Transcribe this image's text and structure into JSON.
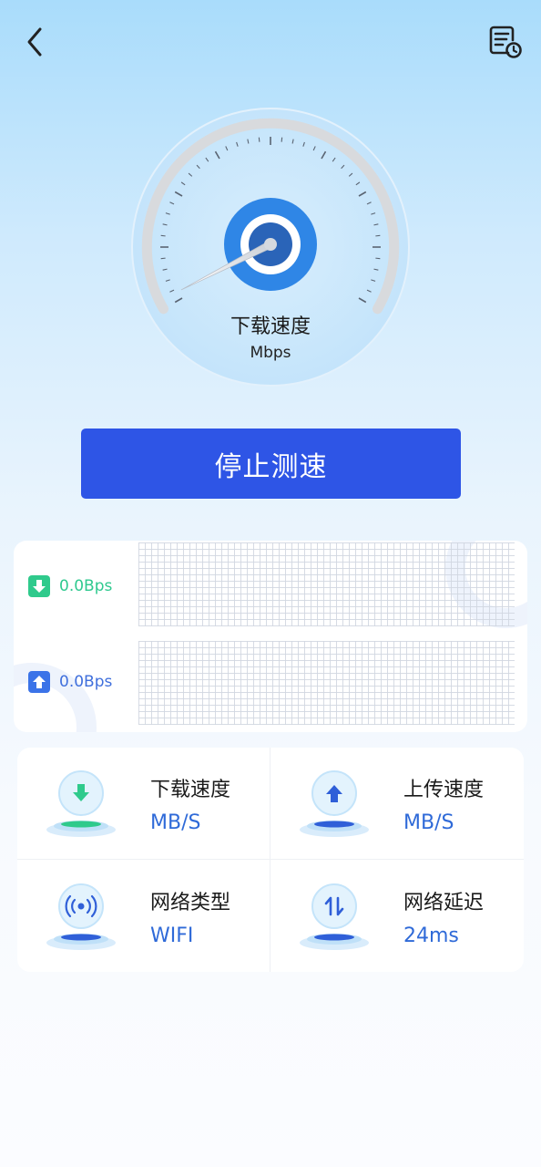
{
  "header": {
    "back_icon": "chevron-left-icon",
    "history_icon": "document-clock-icon"
  },
  "gauge": {
    "label": "下载速度",
    "unit": "Mbps",
    "needle_fraction": 0.0,
    "accent": "#2f86e6"
  },
  "action": {
    "stop_label": "停止测速",
    "color": "#2e55e6"
  },
  "rates": {
    "download": "0.0Bps",
    "upload": "0.0Bps",
    "download_color": "#2fca8c",
    "upload_color": "#3b73e8"
  },
  "stats": [
    {
      "title": "下载速度",
      "value": "MB/S",
      "icon": "download-arrow-icon"
    },
    {
      "title": "上传速度",
      "value": "MB/S",
      "icon": "upload-arrow-icon"
    },
    {
      "title": "网络类型",
      "value": "WIFI",
      "icon": "signal-broadcast-icon"
    },
    {
      "title": "网络延迟",
      "value": "24ms",
      "icon": "up-down-arrows-icon"
    }
  ]
}
